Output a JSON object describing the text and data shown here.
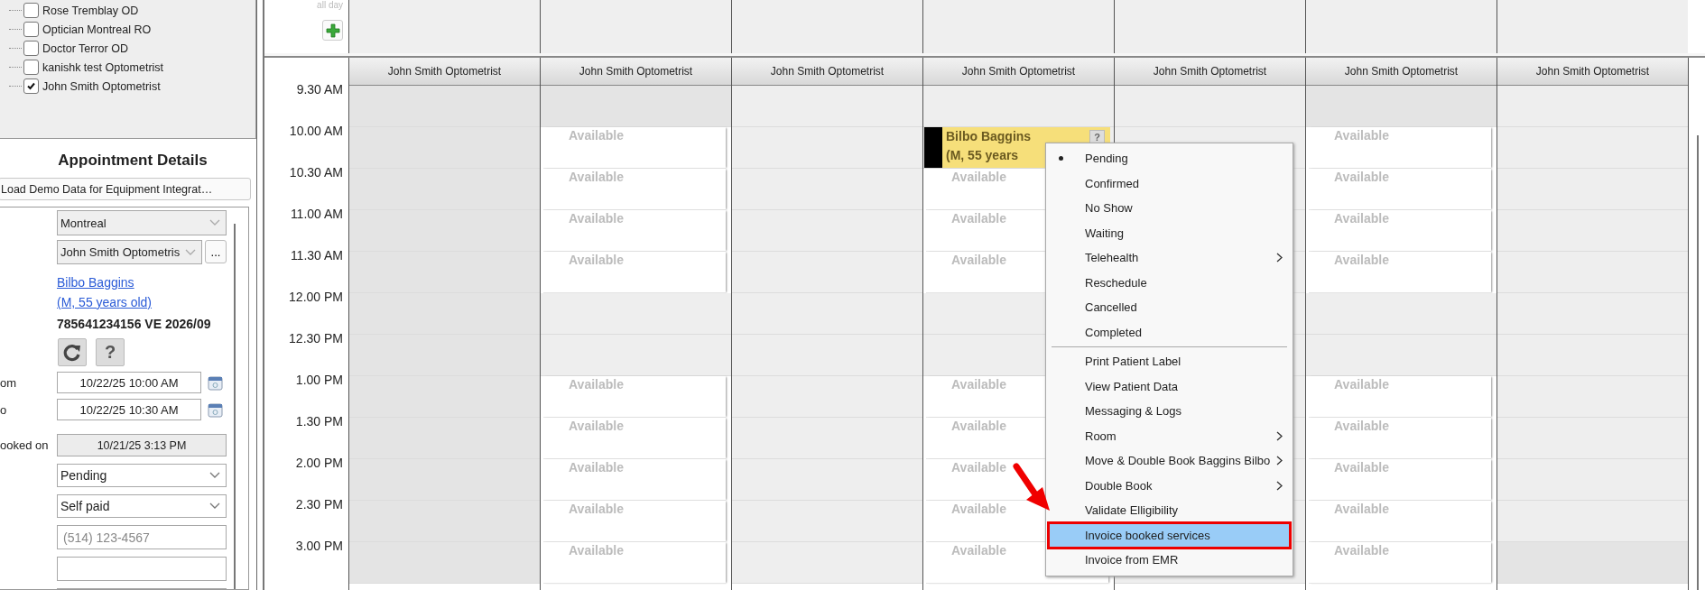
{
  "tree": {
    "items": [
      {
        "label": "Rose Tremblay OD",
        "checked": false
      },
      {
        "label": "Optician Montreal RO",
        "checked": false
      },
      {
        "label": "Doctor Terror OD",
        "checked": false
      },
      {
        "label": "kanishk test Optometrist",
        "checked": false
      },
      {
        "label": "John Smith Optometrist",
        "checked": true
      }
    ]
  },
  "details": {
    "title": "Appointment Details",
    "demo_button": "Load Demo Data for Equipment Integrat…",
    "location": "Montreal",
    "provider": "John Smith Optometris",
    "more_button": "...",
    "patient_name": "Bilbo Baggins",
    "patient_info": "(M, 55 years old)",
    "card": "785641234156 VE 2026/09",
    "help_button": "?",
    "fields": [
      {
        "kind": "date",
        "label": "om",
        "value": "10/22/25 10:00 AM"
      },
      {
        "kind": "date",
        "label": "o",
        "value": "10/22/25 10:30 AM"
      },
      {
        "kind": "readonly",
        "label": "ooked on",
        "value": "10/21/25 3:13 PM"
      },
      {
        "kind": "select",
        "value": "Pending"
      },
      {
        "kind": "select",
        "value": "Self paid"
      },
      {
        "kind": "text",
        "placeholder": "(514) 123-4567"
      },
      {
        "kind": "text"
      },
      {
        "kind": "text"
      }
    ]
  },
  "calendar": {
    "all_day_label": "all day",
    "times": [
      "9.30 AM",
      "10.00 AM",
      "10.30 AM",
      "11.00 AM",
      "11.30 AM",
      "12.00 PM",
      "12.30 PM",
      "1.00 PM",
      "1.30 PM",
      "2.00 PM",
      "2.30 PM",
      "3.00 PM"
    ],
    "columns": [
      {
        "header": "John Smith Optometrist",
        "cells": [
          {
            "kind": "off"
          },
          {
            "kind": "off"
          },
          {
            "kind": "off"
          },
          {
            "kind": "off"
          },
          {
            "kind": "off"
          },
          {
            "kind": "off"
          },
          {
            "kind": "off"
          },
          {
            "kind": "off"
          },
          {
            "kind": "off"
          },
          {
            "kind": "off"
          },
          {
            "kind": "off"
          },
          {
            "kind": "off"
          }
        ]
      },
      {
        "header": "John Smith Optometrist",
        "cells": [
          {
            "kind": "off"
          },
          {
            "kind": "available",
            "text": "Available"
          },
          {
            "kind": "available",
            "text": "Available"
          },
          {
            "kind": "available",
            "text": "Available"
          },
          {
            "kind": "available",
            "text": "Available"
          },
          {
            "kind": "closed"
          },
          {
            "kind": "closed"
          },
          {
            "kind": "available",
            "text": "Available"
          },
          {
            "kind": "available",
            "text": "Available"
          },
          {
            "kind": "available",
            "text": "Available"
          },
          {
            "kind": "available",
            "text": "Available"
          },
          {
            "kind": "available",
            "text": "Available"
          }
        ]
      },
      {
        "header": "John Smith Optometrist",
        "cells": [
          {
            "kind": "closed"
          },
          {
            "kind": "closed"
          },
          {
            "kind": "closed"
          },
          {
            "kind": "closed"
          },
          {
            "kind": "closed"
          },
          {
            "kind": "closed"
          },
          {
            "kind": "closed"
          },
          {
            "kind": "closed"
          },
          {
            "kind": "closed"
          },
          {
            "kind": "closed"
          },
          {
            "kind": "closed"
          },
          {
            "kind": "closed"
          }
        ]
      },
      {
        "header": "John Smith Optometrist",
        "cells": [
          {
            "kind": "closed"
          },
          {
            "kind": "appointment",
            "name": "Bilbo Baggins",
            "detail": "(M, 55 years",
            "badge": "?"
          },
          {
            "kind": "available",
            "text": "Available"
          },
          {
            "kind": "available",
            "text": "Available"
          },
          {
            "kind": "available",
            "text": "Available"
          },
          {
            "kind": "closed"
          },
          {
            "kind": "closed"
          },
          {
            "kind": "available",
            "text": "Available"
          },
          {
            "kind": "available",
            "text": "Available"
          },
          {
            "kind": "available",
            "text": "Available"
          },
          {
            "kind": "available",
            "text": "Available"
          },
          {
            "kind": "available",
            "text": "Available"
          }
        ]
      },
      {
        "header": "John Smith Optometrist",
        "cells": [
          {
            "kind": "closed"
          },
          {
            "kind": "closed"
          },
          {
            "kind": "closed"
          },
          {
            "kind": "closed"
          },
          {
            "kind": "closed"
          },
          {
            "kind": "closed"
          },
          {
            "kind": "closed"
          },
          {
            "kind": "closed"
          },
          {
            "kind": "closed"
          },
          {
            "kind": "closed"
          },
          {
            "kind": "closed"
          },
          {
            "kind": "closed"
          }
        ]
      },
      {
        "header": "John Smith Optometrist",
        "cells": [
          {
            "kind": "off"
          },
          {
            "kind": "available",
            "text": "Available"
          },
          {
            "kind": "available",
            "text": "Available"
          },
          {
            "kind": "available",
            "text": "Available"
          },
          {
            "kind": "available",
            "text": "Available"
          },
          {
            "kind": "closed"
          },
          {
            "kind": "closed"
          },
          {
            "kind": "available",
            "text": "Available"
          },
          {
            "kind": "available",
            "text": "Available"
          },
          {
            "kind": "available",
            "text": "Available"
          },
          {
            "kind": "available",
            "text": "Available"
          },
          {
            "kind": "available",
            "text": "Available"
          }
        ]
      },
      {
        "header": "John Smith Optometrist",
        "cells": [
          {
            "kind": "closed"
          },
          {
            "kind": "closed"
          },
          {
            "kind": "closed"
          },
          {
            "kind": "closed"
          },
          {
            "kind": "closed"
          },
          {
            "kind": "closed"
          },
          {
            "kind": "closed"
          },
          {
            "kind": "closed"
          },
          {
            "kind": "closed"
          },
          {
            "kind": "closed"
          },
          {
            "kind": "closed"
          },
          {
            "kind": "off"
          }
        ]
      }
    ]
  },
  "context_menu": {
    "groups": [
      [
        {
          "label": "Pending",
          "checked": true,
          "submenu": false,
          "selected": false
        },
        {
          "label": "Confirmed",
          "checked": false,
          "submenu": false,
          "selected": false
        },
        {
          "label": "No Show",
          "checked": false,
          "submenu": false,
          "selected": false
        },
        {
          "label": "Waiting",
          "checked": false,
          "submenu": false,
          "selected": false
        },
        {
          "label": "Telehealth",
          "checked": false,
          "submenu": true,
          "selected": false
        },
        {
          "label": "Reschedule",
          "checked": false,
          "submenu": false,
          "selected": false
        },
        {
          "label": "Cancelled",
          "checked": false,
          "submenu": false,
          "selected": false
        },
        {
          "label": "Completed",
          "checked": false,
          "submenu": false,
          "selected": false
        }
      ],
      [
        {
          "label": "Print Patient Label",
          "checked": false,
          "submenu": false,
          "selected": false
        },
        {
          "label": "View Patient Data",
          "checked": false,
          "submenu": false,
          "selected": false
        },
        {
          "label": "Messaging & Logs",
          "checked": false,
          "submenu": false,
          "selected": false
        },
        {
          "label": "Room",
          "checked": false,
          "submenu": true,
          "selected": false
        },
        {
          "label": "Move & Double Book Baggins Bilbo",
          "checked": false,
          "submenu": true,
          "selected": false
        },
        {
          "label": "Double Book",
          "checked": false,
          "submenu": true,
          "selected": false
        },
        {
          "label": "Validate Elligibility",
          "checked": false,
          "submenu": false,
          "selected": false
        },
        {
          "label": "Invoice booked services",
          "checked": false,
          "submenu": false,
          "selected": true
        },
        {
          "label": "Invoice from EMR",
          "checked": false,
          "submenu": false,
          "selected": false
        }
      ]
    ]
  }
}
